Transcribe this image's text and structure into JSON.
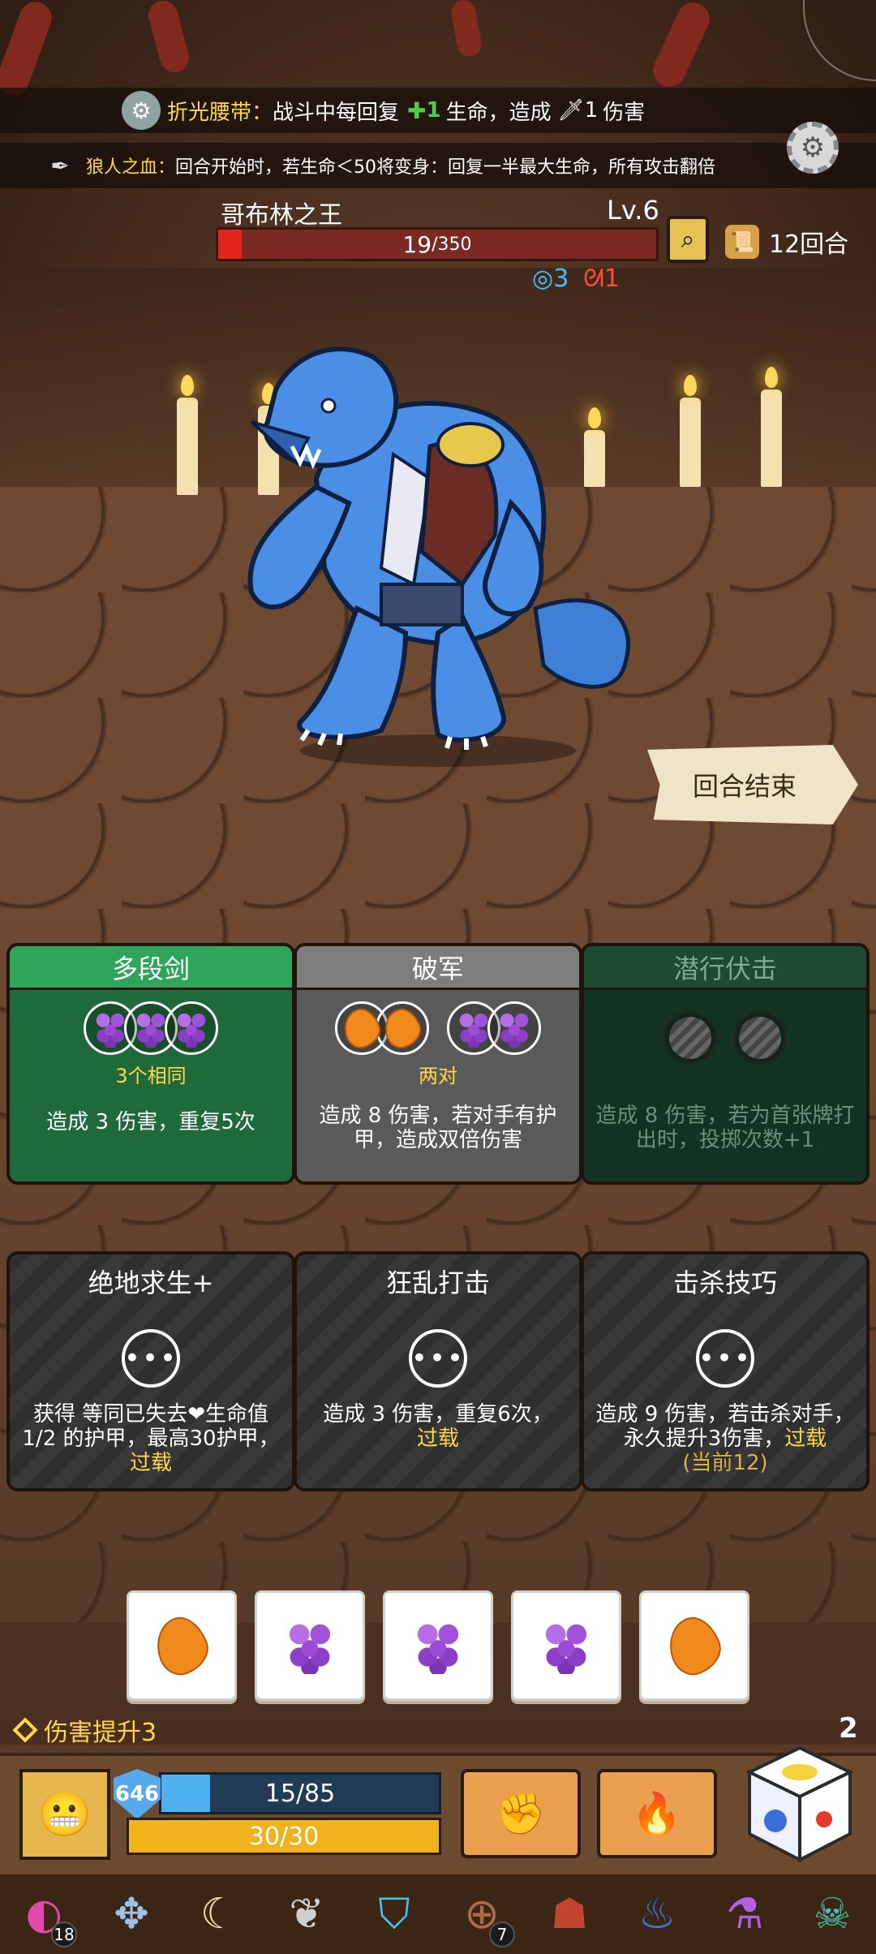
{
  "relics_top": [
    {
      "name": "折光腰带：",
      "text_before": "战斗中每回复",
      "heal_amount": "1",
      "text_mid": "生命，造成",
      "damage_amount": "1",
      "text_after": "伤害",
      "icon": "gear-belt-icon"
    },
    {
      "name": "狼人之血：",
      "text": "回合开始时，若生命＜50将变身：回复一半最大生命，所有攻击翻倍",
      "icon": "wolf-claw-icon"
    }
  ],
  "enemy": {
    "name": "哥布林之王",
    "level": "Lv.6",
    "hp_current": "19",
    "hp_max": " /350",
    "hp_fraction": 0.054,
    "status": [
      {
        "icon": "dodge-icon",
        "value": "3"
      },
      {
        "icon": "bleed-icon",
        "value": "1"
      }
    ]
  },
  "turn_counter": "12回合",
  "end_turn_label": "回合结束",
  "ability_cards": [
    {
      "title": "多段剑",
      "condition": "3个相同",
      "desc": "造成 3 伤害，重复5次"
    },
    {
      "title": "破军",
      "condition": "两对",
      "desc": "造成 8 伤害，若对手有护甲，造成双倍伤害"
    },
    {
      "title": "潜行伏击",
      "desc": "造成 8 伤害，若为首张牌打出时，投掷次数+1"
    }
  ],
  "locked_cards": [
    {
      "title": "绝地求生+",
      "desc": "获得 等同已失去❤生命值1/2 的护甲，最高30护甲，",
      "overload": "过载"
    },
    {
      "title": "狂乱打击",
      "desc": "造成 3 伤害，重复6次，",
      "overload": "过载"
    },
    {
      "title": "击杀技巧",
      "desc": "造成 9 伤害，若击杀对手，永久提升3伤害，",
      "overload": "过载",
      "extra": "(当前12)"
    }
  ],
  "dice": [
    "mango",
    "grape",
    "grape",
    "grape",
    "mango"
  ],
  "damage_bonus": "伤害提升3",
  "rolls_left": "2",
  "player": {
    "armor": "646",
    "armor_text": "15/85",
    "armor_fraction": 0.176,
    "life_text": "30/30",
    "life_fraction": 1.0
  },
  "relic_strip": [
    {
      "icon": "crescent-orb-icon",
      "badge": "18"
    },
    {
      "icon": "compass-cross-icon"
    },
    {
      "icon": "claw-icon"
    },
    {
      "icon": "feather-icon"
    },
    {
      "icon": "frost-shield-icon"
    },
    {
      "icon": "button-coin-icon",
      "badge": "7"
    },
    {
      "icon": "hood-icon"
    },
    {
      "icon": "blue-flame-icon"
    },
    {
      "icon": "potion-icon"
    },
    {
      "icon": "demon-mask-icon"
    }
  ],
  "colors": {
    "accent_yellow": "#ffd84a",
    "heal_green": "#4fd04a",
    "hp_red": "#e3261b",
    "dodge_blue": "#43c2ff"
  }
}
